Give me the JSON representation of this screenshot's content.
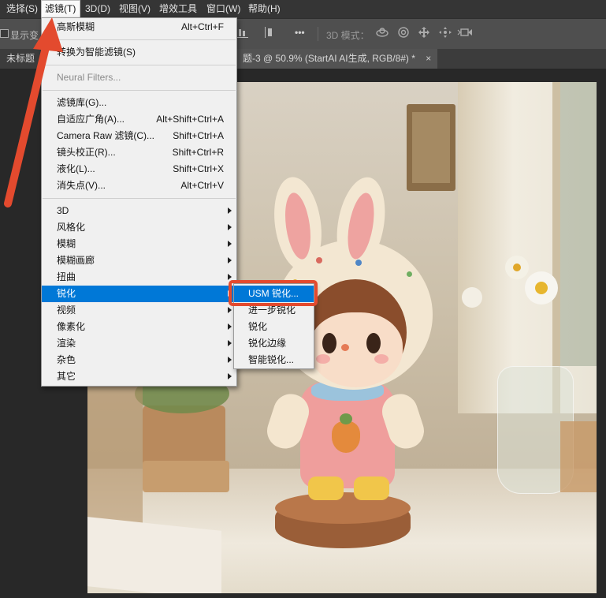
{
  "menubar": {
    "items": [
      {
        "label": "选择(S)"
      },
      {
        "label": "滤镜(T)"
      },
      {
        "label": "3D(D)"
      },
      {
        "label": "视图(V)"
      },
      {
        "label": "增效工具"
      },
      {
        "label": "窗口(W)"
      },
      {
        "label": "帮助(H)"
      }
    ]
  },
  "options_bar": {
    "show_transform_label": "显示变",
    "mode_3d_label": "3D 模式：",
    "more_label": "•••"
  },
  "tabs": {
    "tab1_label": "未标题",
    "tab2_label": "题-3 @ 50.9% (StartAI AI生成, RGB/8#) *",
    "close_glyph": "×"
  },
  "filter_menu": {
    "items": [
      {
        "label": "高斯模糊",
        "shortcut": "Alt+Ctrl+F"
      },
      {
        "label": "转换为智能滤镜(S)",
        "shortcut": ""
      },
      {
        "label": "Neural Filters...",
        "shortcut": ""
      },
      {
        "label": "滤镜库(G)...",
        "shortcut": ""
      },
      {
        "label": "自适应广角(A)...",
        "shortcut": "Alt+Shift+Ctrl+A"
      },
      {
        "label": "Camera Raw 滤镜(C)...",
        "shortcut": "Shift+Ctrl+A"
      },
      {
        "label": "镜头校正(R)...",
        "shortcut": "Shift+Ctrl+R"
      },
      {
        "label": "液化(L)...",
        "shortcut": "Shift+Ctrl+X"
      },
      {
        "label": "消失点(V)...",
        "shortcut": "Alt+Ctrl+V"
      },
      {
        "label": "3D"
      },
      {
        "label": "风格化"
      },
      {
        "label": "模糊"
      },
      {
        "label": "模糊画廊"
      },
      {
        "label": "扭曲"
      },
      {
        "label": "锐化"
      },
      {
        "label": "视频"
      },
      {
        "label": "像素化"
      },
      {
        "label": "渲染"
      },
      {
        "label": "杂色"
      },
      {
        "label": "其它"
      }
    ]
  },
  "sharpen_submenu": {
    "items": [
      {
        "label": "USM 锐化..."
      },
      {
        "label": "进一步锐化"
      },
      {
        "label": "锐化"
      },
      {
        "label": "锐化边缘"
      },
      {
        "label": "智能锐化..."
      }
    ]
  },
  "colors": {
    "highlight": "#0078d7",
    "annotation": "#e34a2e",
    "menu_bg": "#f0f0f0"
  }
}
